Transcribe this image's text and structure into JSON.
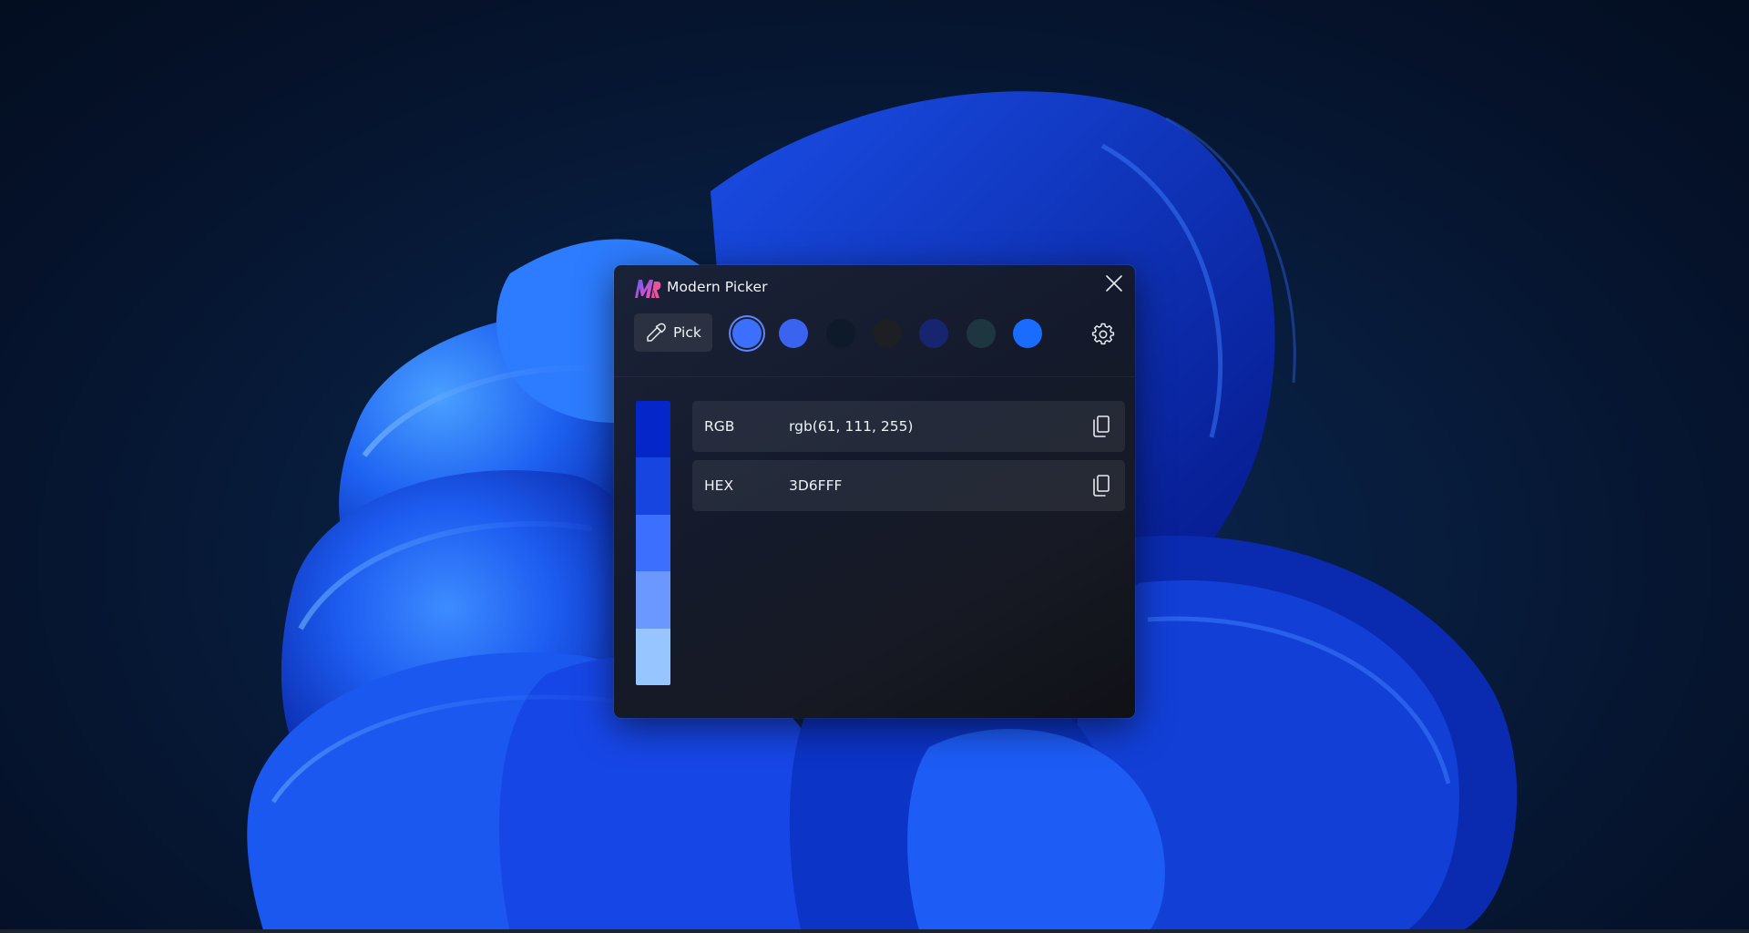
{
  "window": {
    "title": "Modern Picker",
    "logo_icon": "modern-picker-logo",
    "close_icon": "close-icon"
  },
  "toolbar": {
    "pick_label": "Pick",
    "pick_icon": "eyedropper-icon",
    "settings_icon": "gear-icon",
    "history": [
      {
        "color": "#3d6fff",
        "selected": true
      },
      {
        "color": "#3a63f0",
        "selected": false
      },
      {
        "color": "#0e1a2a",
        "selected": false
      },
      {
        "color": "#1d1f22",
        "selected": false
      },
      {
        "color": "#172470",
        "selected": false
      },
      {
        "color": "#1d3640",
        "selected": false
      },
      {
        "color": "#1a6cff",
        "selected": false
      }
    ]
  },
  "shades": [
    "#0526c9",
    "#1745e0",
    "#3d6fff",
    "#6b98ff",
    "#97c5ff"
  ],
  "formats": [
    {
      "label": "RGB",
      "value": "rgb(61, 111, 255)",
      "copy_icon": "copy-icon"
    },
    {
      "label": "HEX",
      "value": "3D6FFF",
      "copy_icon": "copy-icon"
    }
  ]
}
